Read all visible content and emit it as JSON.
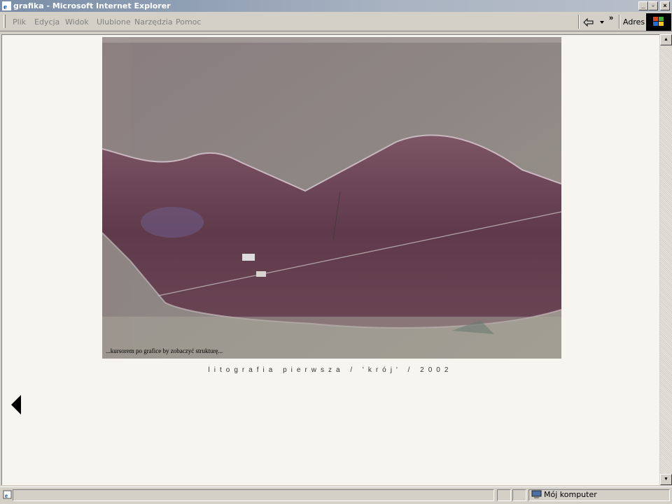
{
  "window": {
    "title": "grafika - Microsoft Internet Explorer",
    "controls": [
      "_",
      "▫",
      "×"
    ]
  },
  "menubar": {
    "items": [
      {
        "label": "Plik"
      },
      {
        "label": "Edycja"
      },
      {
        "label": "Widok"
      },
      {
        "label": "Ulubione"
      },
      {
        "label": "Narzędzia"
      },
      {
        "label": "Pomoc"
      }
    ],
    "address_label": "Adres",
    "more_glyph": "»"
  },
  "page": {
    "art_caption": "...kursorem po grafice by zobaczyć strukturę...",
    "subtitle": "litografia pierwsza / 'krój' / 2002"
  },
  "status": {
    "zone": "Mój komputer"
  },
  "icons": [
    "ie-icon",
    "back-arrow-icon",
    "dropdown-arrow-icon",
    "windows-logo-icon",
    "previous-arrow-icon",
    "computer-icon"
  ]
}
